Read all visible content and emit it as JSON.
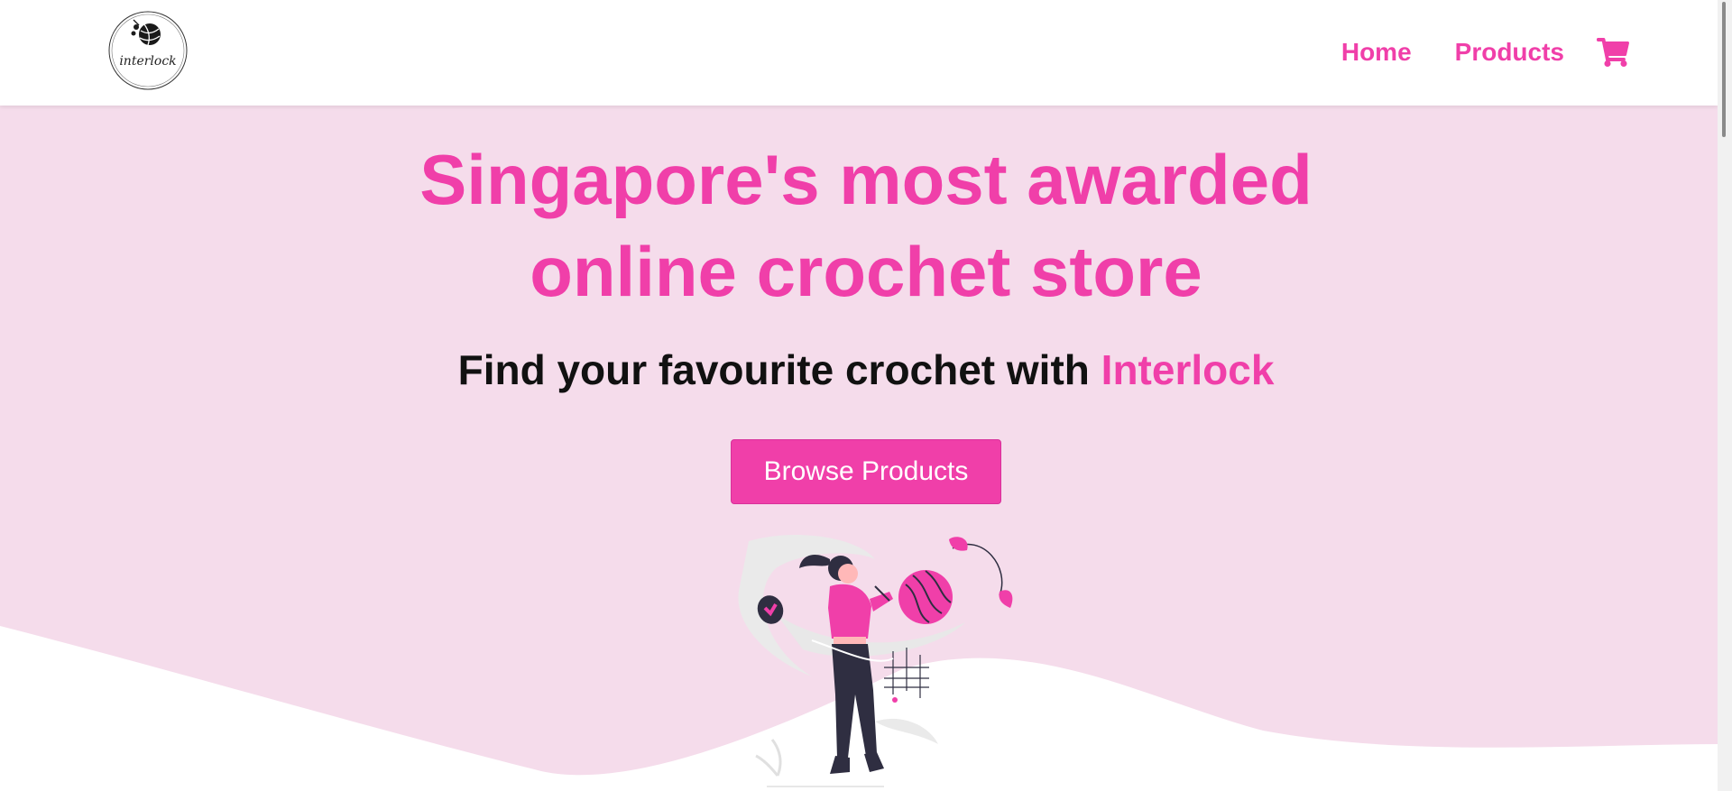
{
  "header": {
    "logo_text": "interlock",
    "nav": {
      "home_label": "Home",
      "products_label": "Products"
    },
    "cart_icon": "shopping-cart-icon"
  },
  "hero": {
    "title_line1": "Singapore's most awarded",
    "title_line2": "online crochet store",
    "subtitle_prefix": "Find your favourite crochet with ",
    "subtitle_brand": "Interlock",
    "cta_label": "Browse Products"
  },
  "colors": {
    "accent": "#f03fa9",
    "hero_background": "#f5dceb",
    "header_background": "#ffffff",
    "text_dark": "#111111"
  }
}
